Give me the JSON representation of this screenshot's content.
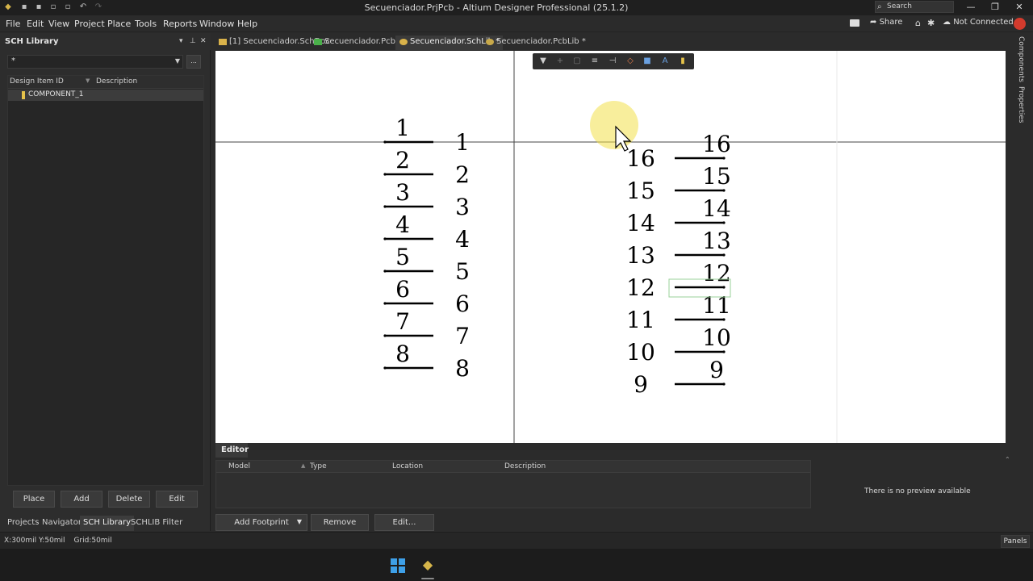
{
  "titlebar": {
    "title": "Secuenciador.PrjPcb - Altium Designer Professional (25.1.2)",
    "search_placeholder": "Search"
  },
  "menu": {
    "items": [
      "File",
      "Edit",
      "View",
      "Project",
      "Place",
      "Tools",
      "Reports",
      "Window",
      "Help"
    ],
    "share": "Share",
    "connection": "Not Connected"
  },
  "left_panel": {
    "title": "SCH Library",
    "filter_value": "*",
    "more_label": "...",
    "columns": [
      "Design Item ID",
      "Description"
    ],
    "rows": [
      {
        "id": "COMPONENT_1",
        "description": ""
      }
    ],
    "buttons": [
      "Place",
      "Add",
      "Delete",
      "Edit"
    ],
    "tabs": [
      "Projects",
      "Navigator",
      "SCH Library",
      "SCHLIB Filter"
    ],
    "active_tab": "SCH Library"
  },
  "doc_tabs": [
    {
      "label": "[1] Secuenciador.SchDoc",
      "active": false
    },
    {
      "label": "Secuenciador.PcbDoc",
      "active": false
    },
    {
      "label": "Secuenciador.SchLib *",
      "active": true
    },
    {
      "label": "Secuenciador.PcbLib *",
      "active": false
    }
  ],
  "canvas": {
    "left_pins": {
      "names": [
        "1",
        "2",
        "3",
        "4",
        "5",
        "6",
        "7",
        "8"
      ],
      "designators": [
        "1",
        "2",
        "3",
        "4",
        "5",
        "6",
        "7",
        "8"
      ]
    },
    "right_pins": {
      "names": [
        "16",
        "15",
        "14",
        "13",
        "12",
        "11",
        "10",
        "9"
      ],
      "designators": [
        "16",
        "15",
        "14",
        "13",
        "12",
        "11",
        "10",
        "9"
      ]
    }
  },
  "right_strip": {
    "tabs": [
      "Components",
      "Properties"
    ]
  },
  "editor": {
    "title": "Editor",
    "columns": [
      "Model",
      "Type",
      "Location",
      "Description"
    ],
    "buttons": [
      "Add Footprint",
      "Remove",
      "Edit..."
    ],
    "preview_text": "There is no preview available"
  },
  "status": {
    "coords": "X:300mil Y:50mil",
    "grid": "Grid:50mil",
    "panels": "Panels"
  },
  "colors": {
    "accent": "#d43b2d",
    "highlight": "#f2e04a",
    "component_chip": "#e6c34a"
  }
}
